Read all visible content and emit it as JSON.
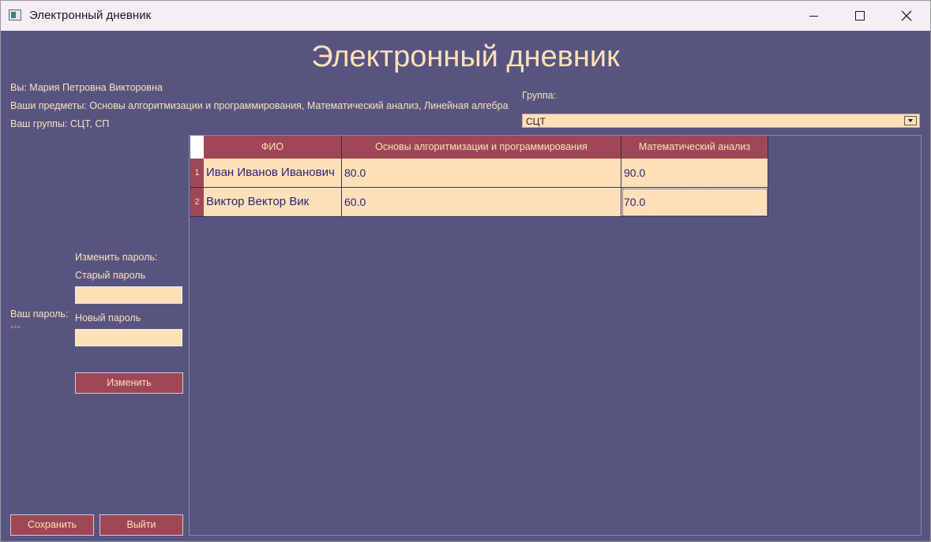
{
  "window": {
    "title": "Электронный дневник"
  },
  "app": {
    "title": "Электронный дневник"
  },
  "user_info": {
    "name_line": "Вы: Мария Петровна Викторовна",
    "subjects_line": "Ваши предметы: Основы алгоритмизации и программирования, Математический анализ, Линейная алгебра",
    "groups_line": "Ваш группы: СЦТ, СП"
  },
  "group": {
    "label": "Группа:",
    "selected": "СЦТ"
  },
  "table": {
    "columns": [
      "ФИО",
      "Основы алгоритмизации и программирования",
      "Математический анализ"
    ],
    "rows": [
      {
        "num": "1",
        "name": "Иван Иванов Иванович",
        "cells": [
          "80.0",
          "90.0"
        ]
      },
      {
        "num": "2",
        "name": "Виктор Вектор Вик",
        "cells": [
          "60.0",
          "70.0"
        ]
      }
    ]
  },
  "password": {
    "your_label": "Ваш пароль:",
    "your_value": "***",
    "change_heading": "Изменить пароль:",
    "old_label": "Старый пароль",
    "old_value": "",
    "new_label": "Новый пароль",
    "new_value": "",
    "change_button": "Изменить"
  },
  "footer": {
    "save_button": "Сохранить",
    "exit_button": "Выйти"
  },
  "colors": {
    "background": "#575580",
    "accent": "#9e4756",
    "cell": "#fde0b8",
    "text_light": "#fde0b8",
    "text_dark": "#2b2478"
  },
  "icons": {
    "app": "app-window-icon",
    "minimize": "minimize-icon",
    "maximize": "maximize-icon",
    "close": "close-icon",
    "dropdown": "chevron-down-icon"
  }
}
